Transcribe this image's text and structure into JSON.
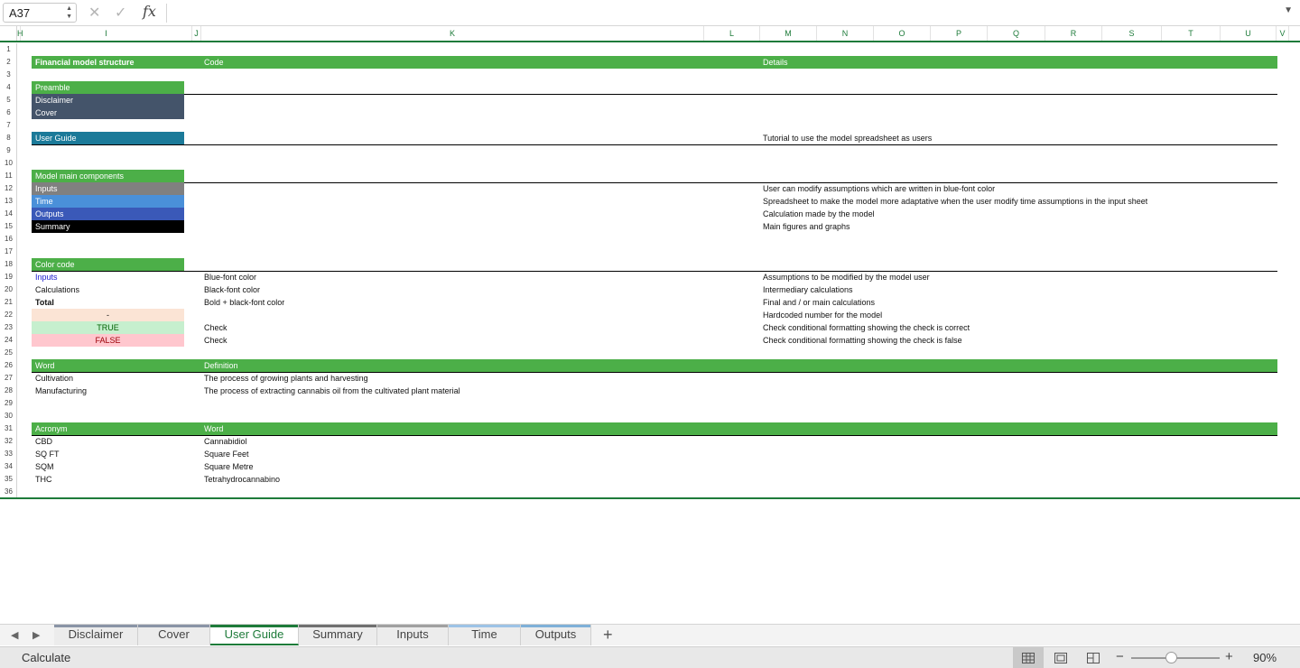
{
  "formula_bar": {
    "name_box": "A37",
    "fx": "fx",
    "formula": ""
  },
  "columns": [
    "H",
    "I",
    "J",
    "K",
    "L",
    "M",
    "N",
    "O",
    "P",
    "Q",
    "R",
    "S",
    "T",
    "U",
    "V"
  ],
  "rows": [
    "1",
    "2",
    "3",
    "4",
    "5",
    "6",
    "7",
    "8",
    "9",
    "10",
    "11",
    "12",
    "13",
    "14",
    "15",
    "16",
    "17",
    "18",
    "19",
    "20",
    "21",
    "22",
    "23",
    "24",
    "25",
    "26",
    "27",
    "28",
    "29",
    "30",
    "31",
    "32",
    "33",
    "34",
    "35",
    "36"
  ],
  "sheet": {
    "header": {
      "structure": "Financial model structure",
      "code": "Code",
      "details": "Details"
    },
    "preamble": {
      "title": "Preamble",
      "disclaimer": "Disclaimer",
      "cover": "Cover"
    },
    "user_guide": {
      "label": "User Guide",
      "detail": "Tutorial to use the model spreadsheet as users"
    },
    "components": {
      "title": "Model main components",
      "items": [
        {
          "label": "Inputs",
          "detail": "User can modify assumptions which are written in blue-font color",
          "color": "#808080"
        },
        {
          "label": "Time",
          "detail": "Spreadsheet to make the model more adaptative when the user modify time assumptions in the input sheet",
          "color": "#4a90d9"
        },
        {
          "label": "Outputs",
          "detail": "Calculation made by the model",
          "color": "#3a59b8"
        },
        {
          "label": "Summary",
          "detail": "Main figures and graphs",
          "color": "#000000"
        }
      ]
    },
    "color_code": {
      "title": "Color code",
      "items": [
        {
          "label": "Inputs",
          "code": "Blue-font color",
          "detail": "Assumptions to be modified by the model user"
        },
        {
          "label": "Calculations",
          "code": "Black-font color",
          "detail": "Intermediary calculations"
        },
        {
          "label": "Total",
          "code": "Bold + black-font color",
          "detail": "Final  and / or main calculations"
        },
        {
          "label": "-",
          "code": "",
          "detail": "Hardcoded number for the model"
        },
        {
          "label": "TRUE",
          "code": "Check",
          "detail": "Check conditional formatting showing the check is correct"
        },
        {
          "label": "FALSE",
          "code": "Check",
          "detail": "Check conditional formatting showing the check is false"
        }
      ]
    },
    "words": {
      "header_word": "Word",
      "header_def": "Definition",
      "items": [
        {
          "word": "Cultivation",
          "def": " The process of growing plants and harvesting"
        },
        {
          "word": "Manufacturing",
          "def": "The process of extracting cannabis oil from the cultivated plant material"
        }
      ]
    },
    "acronyms": {
      "header_acr": "Acronym",
      "header_word": "Word",
      "items": [
        {
          "acr": "CBD",
          "word": "Cannabidiol"
        },
        {
          "acr": "SQ FT",
          "word": "Square Feet"
        },
        {
          "acr": "SQM",
          "word": "Square Metre"
        },
        {
          "acr": "THC",
          "word": "Tetrahydrocannabino"
        }
      ]
    }
  },
  "tabs": [
    {
      "label": "Disclaimer",
      "color": "#8a94a6"
    },
    {
      "label": "Cover",
      "color": "#8a94a6"
    },
    {
      "label": "User Guide",
      "color": "#1e7b3a"
    },
    {
      "label": "Summary",
      "color": "#707070"
    },
    {
      "label": "Inputs",
      "color": "#a0a0a0"
    },
    {
      "label": "Time",
      "color": "#9dc3e6"
    },
    {
      "label": "Outputs",
      "color": "#7fb0d8"
    }
  ],
  "status": {
    "text": "Calculate",
    "zoom": "90%"
  },
  "colors": {
    "accent": "#1e7b3a",
    "green": "#4caf48",
    "navy": "#44546a",
    "teal": "#1b7a99",
    "input_blue": "#1a1acc",
    "hardcoded": "#fbe4d5",
    "true_bg": "#c6efce",
    "true_fg": "#006100",
    "false_bg": "#ffc7ce",
    "false_fg": "#9c0006"
  }
}
